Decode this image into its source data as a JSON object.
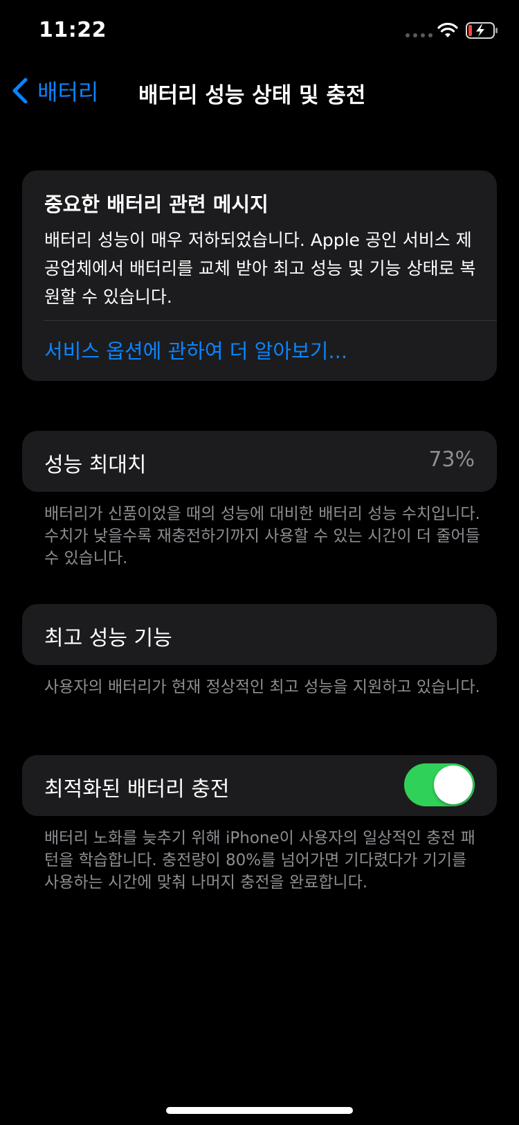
{
  "status_bar": {
    "time": "11:22"
  },
  "nav": {
    "back_label": "배터리",
    "title": "배터리 성능 상태 및 충전"
  },
  "notice": {
    "title": "중요한 배터리 관련 메시지",
    "body": "배터리 성능이 매우 저하되었습니다. Apple 공인 서비스 제공업체에서 배터리를 교체 받아 최고 성능 및 기능 상태로 복원할 수 있습니다.",
    "link": "서비스 옵션에 관하여 더 알아보기..."
  },
  "peak_capacity": {
    "label": "성능 최대치",
    "value": "73%",
    "footnote": "배터리가 신품이었을 때의 성능에 대비한 배터리 성능 수치입니다. 수치가 낮을수록 재충전하기까지 사용할 수 있는 시간이 더 줄어들 수 있습니다."
  },
  "peak_performance": {
    "label": "최고 성능 기능",
    "footnote": "사용자의 배터리가 현재 정상적인 최고 성능을 지원하고 있습니다."
  },
  "optimized_charging": {
    "label": "최적화된 배터리 충전",
    "enabled": true,
    "footnote": "배터리 노화를 늦추기 위해 iPhone이 사용자의 일상적인 충전 패턴을 학습합니다. 충전량이 80%를 넘어가면 기다렸다가 기기를 사용하는 시간에 맞춰 나머지 충전을 완료합니다."
  },
  "colors": {
    "accent": "#0a84ff",
    "toggle_on": "#30d158",
    "card": "#1c1c1e",
    "secondary_text": "#8e8e93"
  },
  "icons": {
    "back": "chevron-left-icon",
    "wifi": "wifi-icon",
    "battery": "battery-charging-icon",
    "signal": "cellular-signal-icon"
  }
}
